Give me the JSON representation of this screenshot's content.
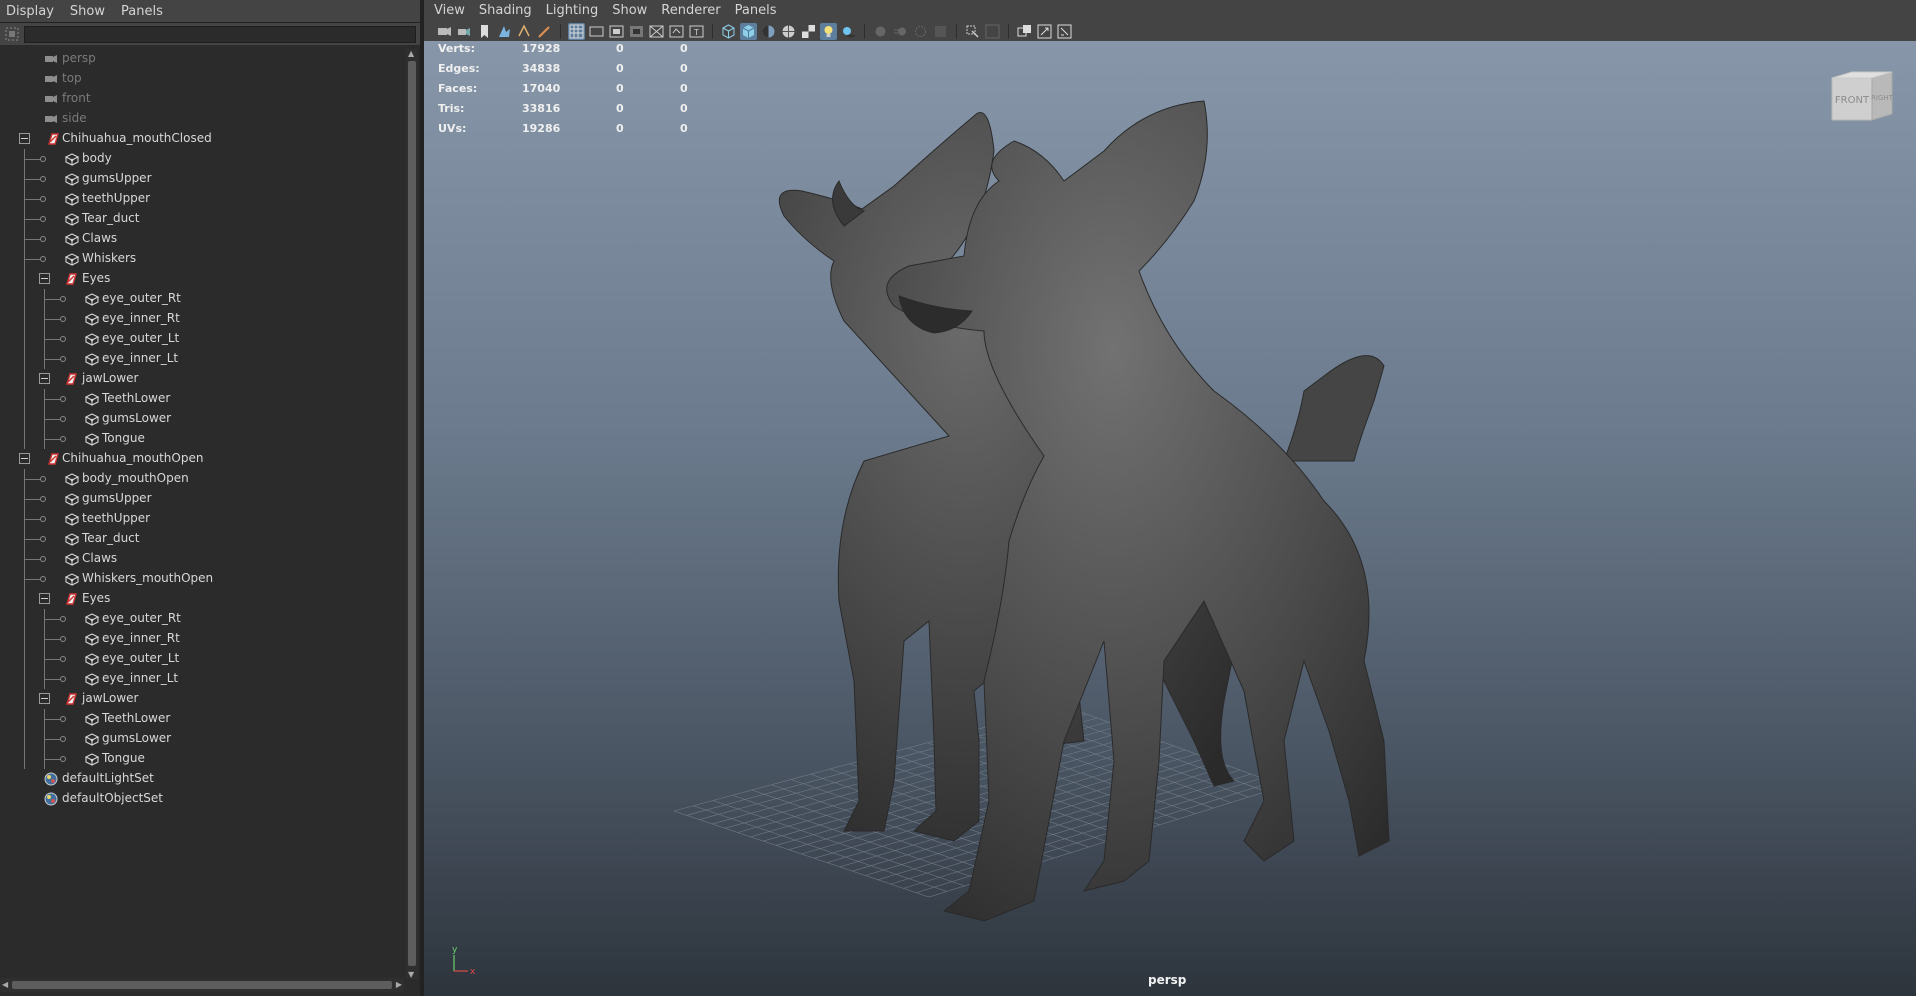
{
  "outliner": {
    "menu": [
      "Display",
      "Show",
      "Panels"
    ],
    "search_value": "",
    "nodes": [
      {
        "label": "persp",
        "type": "camera",
        "depth": 0,
        "dim": true
      },
      {
        "label": "top",
        "type": "camera",
        "depth": 0,
        "dim": true
      },
      {
        "label": "front",
        "type": "camera",
        "depth": 0,
        "dim": true
      },
      {
        "label": "side",
        "type": "camera",
        "depth": 0,
        "dim": true
      },
      {
        "label": "Chihuahua_mouthClosed",
        "type": "group",
        "depth": 0,
        "expanded": true
      },
      {
        "label": "body",
        "type": "mesh",
        "depth": 1
      },
      {
        "label": "gumsUpper",
        "type": "mesh",
        "depth": 1
      },
      {
        "label": "teethUpper",
        "type": "mesh",
        "depth": 1
      },
      {
        "label": "Tear_duct",
        "type": "mesh",
        "depth": 1
      },
      {
        "label": "Claws",
        "type": "mesh",
        "depth": 1
      },
      {
        "label": "Whiskers",
        "type": "mesh",
        "depth": 1
      },
      {
        "label": "Eyes",
        "type": "group",
        "depth": 1,
        "expanded": true
      },
      {
        "label": "eye_outer_Rt",
        "type": "mesh",
        "depth": 2
      },
      {
        "label": "eye_inner_Rt",
        "type": "mesh",
        "depth": 2
      },
      {
        "label": "eye_outer_Lt",
        "type": "mesh",
        "depth": 2
      },
      {
        "label": "eye_inner_Lt",
        "type": "mesh",
        "depth": 2
      },
      {
        "label": "jawLower",
        "type": "group",
        "depth": 1,
        "expanded": true
      },
      {
        "label": "TeethLower",
        "type": "mesh",
        "depth": 2
      },
      {
        "label": "gumsLower",
        "type": "mesh",
        "depth": 2
      },
      {
        "label": "Tongue",
        "type": "mesh",
        "depth": 2
      },
      {
        "label": "Chihuahua_mouthOpen",
        "type": "group",
        "depth": 0,
        "expanded": true
      },
      {
        "label": "body_mouthOpen",
        "type": "mesh",
        "depth": 1
      },
      {
        "label": "gumsUpper",
        "type": "mesh",
        "depth": 1
      },
      {
        "label": "teethUpper",
        "type": "mesh",
        "depth": 1
      },
      {
        "label": "Tear_duct",
        "type": "mesh",
        "depth": 1
      },
      {
        "label": "Claws",
        "type": "mesh",
        "depth": 1
      },
      {
        "label": "Whiskers_mouthOpen",
        "type": "mesh",
        "depth": 1
      },
      {
        "label": "Eyes",
        "type": "group",
        "depth": 1,
        "expanded": true
      },
      {
        "label": "eye_outer_Rt",
        "type": "mesh",
        "depth": 2
      },
      {
        "label": "eye_inner_Rt",
        "type": "mesh",
        "depth": 2
      },
      {
        "label": "eye_outer_Lt",
        "type": "mesh",
        "depth": 2
      },
      {
        "label": "eye_inner_Lt",
        "type": "mesh",
        "depth": 2
      },
      {
        "label": "jawLower",
        "type": "group",
        "depth": 1,
        "expanded": true
      },
      {
        "label": "TeethLower",
        "type": "mesh",
        "depth": 2
      },
      {
        "label": "gumsLower",
        "type": "mesh",
        "depth": 2
      },
      {
        "label": "Tongue",
        "type": "mesh",
        "depth": 2
      },
      {
        "label": "defaultLightSet",
        "type": "set",
        "depth": 0
      },
      {
        "label": "defaultObjectSet",
        "type": "set",
        "depth": 0
      }
    ]
  },
  "viewport": {
    "menu": [
      "View",
      "Shading",
      "Lighting",
      "Show",
      "Renderer",
      "Panels"
    ],
    "toolbar_icons": [
      "select-camera-icon",
      "camera-attributes-icon",
      "bookmark-icon",
      "image-plane-icon",
      "two-d-pan-zoom-icon",
      "grease-pencil-icon",
      "sep",
      "grid-icon",
      "film-gate-icon",
      "resolution-gate-icon",
      "gate-mask-icon",
      "field-chart-icon",
      "safe-action-icon",
      "safe-title-icon",
      "sep",
      "wireframe-icon",
      "smooth-shade-icon",
      "use-default-material-icon",
      "wireframe-on-shaded-icon",
      "textured-icon",
      "use-all-lights-icon",
      "shadows-icon",
      "sep",
      "screen-space-ambient-occlusion-icon",
      "motion-blur-icon",
      "multisample-antialiasing-icon",
      "depth-of-field-icon",
      "sep",
      "isolate-select-icon",
      "xray-icon",
      "sep",
      "xray-active-components-icon",
      "xray-joints-icon",
      "backface-culling-icon"
    ],
    "active_toolbar_icons": [
      "grid-icon",
      "smooth-shade-icon",
      "use-all-lights-icon"
    ],
    "hud": [
      {
        "label": "Verts:",
        "value": "17928",
        "selected": "0",
        "uv": "0"
      },
      {
        "label": "Edges:",
        "value": "34838",
        "selected": "0",
        "uv": "0"
      },
      {
        "label": "Faces:",
        "value": "17040",
        "selected": "0",
        "uv": "0"
      },
      {
        "label": "Tris:",
        "value": "33816",
        "selected": "0",
        "uv": "0"
      },
      {
        "label": "UVs:",
        "value": "19286",
        "selected": "0",
        "uv": "0"
      }
    ],
    "viewcube": {
      "front": "FRONT",
      "right": "RIGHT"
    },
    "camera_name": "persp",
    "axis": {
      "y": "y",
      "x": "x"
    },
    "colors": {
      "bg_top": "#8797a9",
      "bg_bottom": "#2d343c",
      "accent": "#5e7e9e",
      "dog": "#4a4a4a"
    }
  }
}
